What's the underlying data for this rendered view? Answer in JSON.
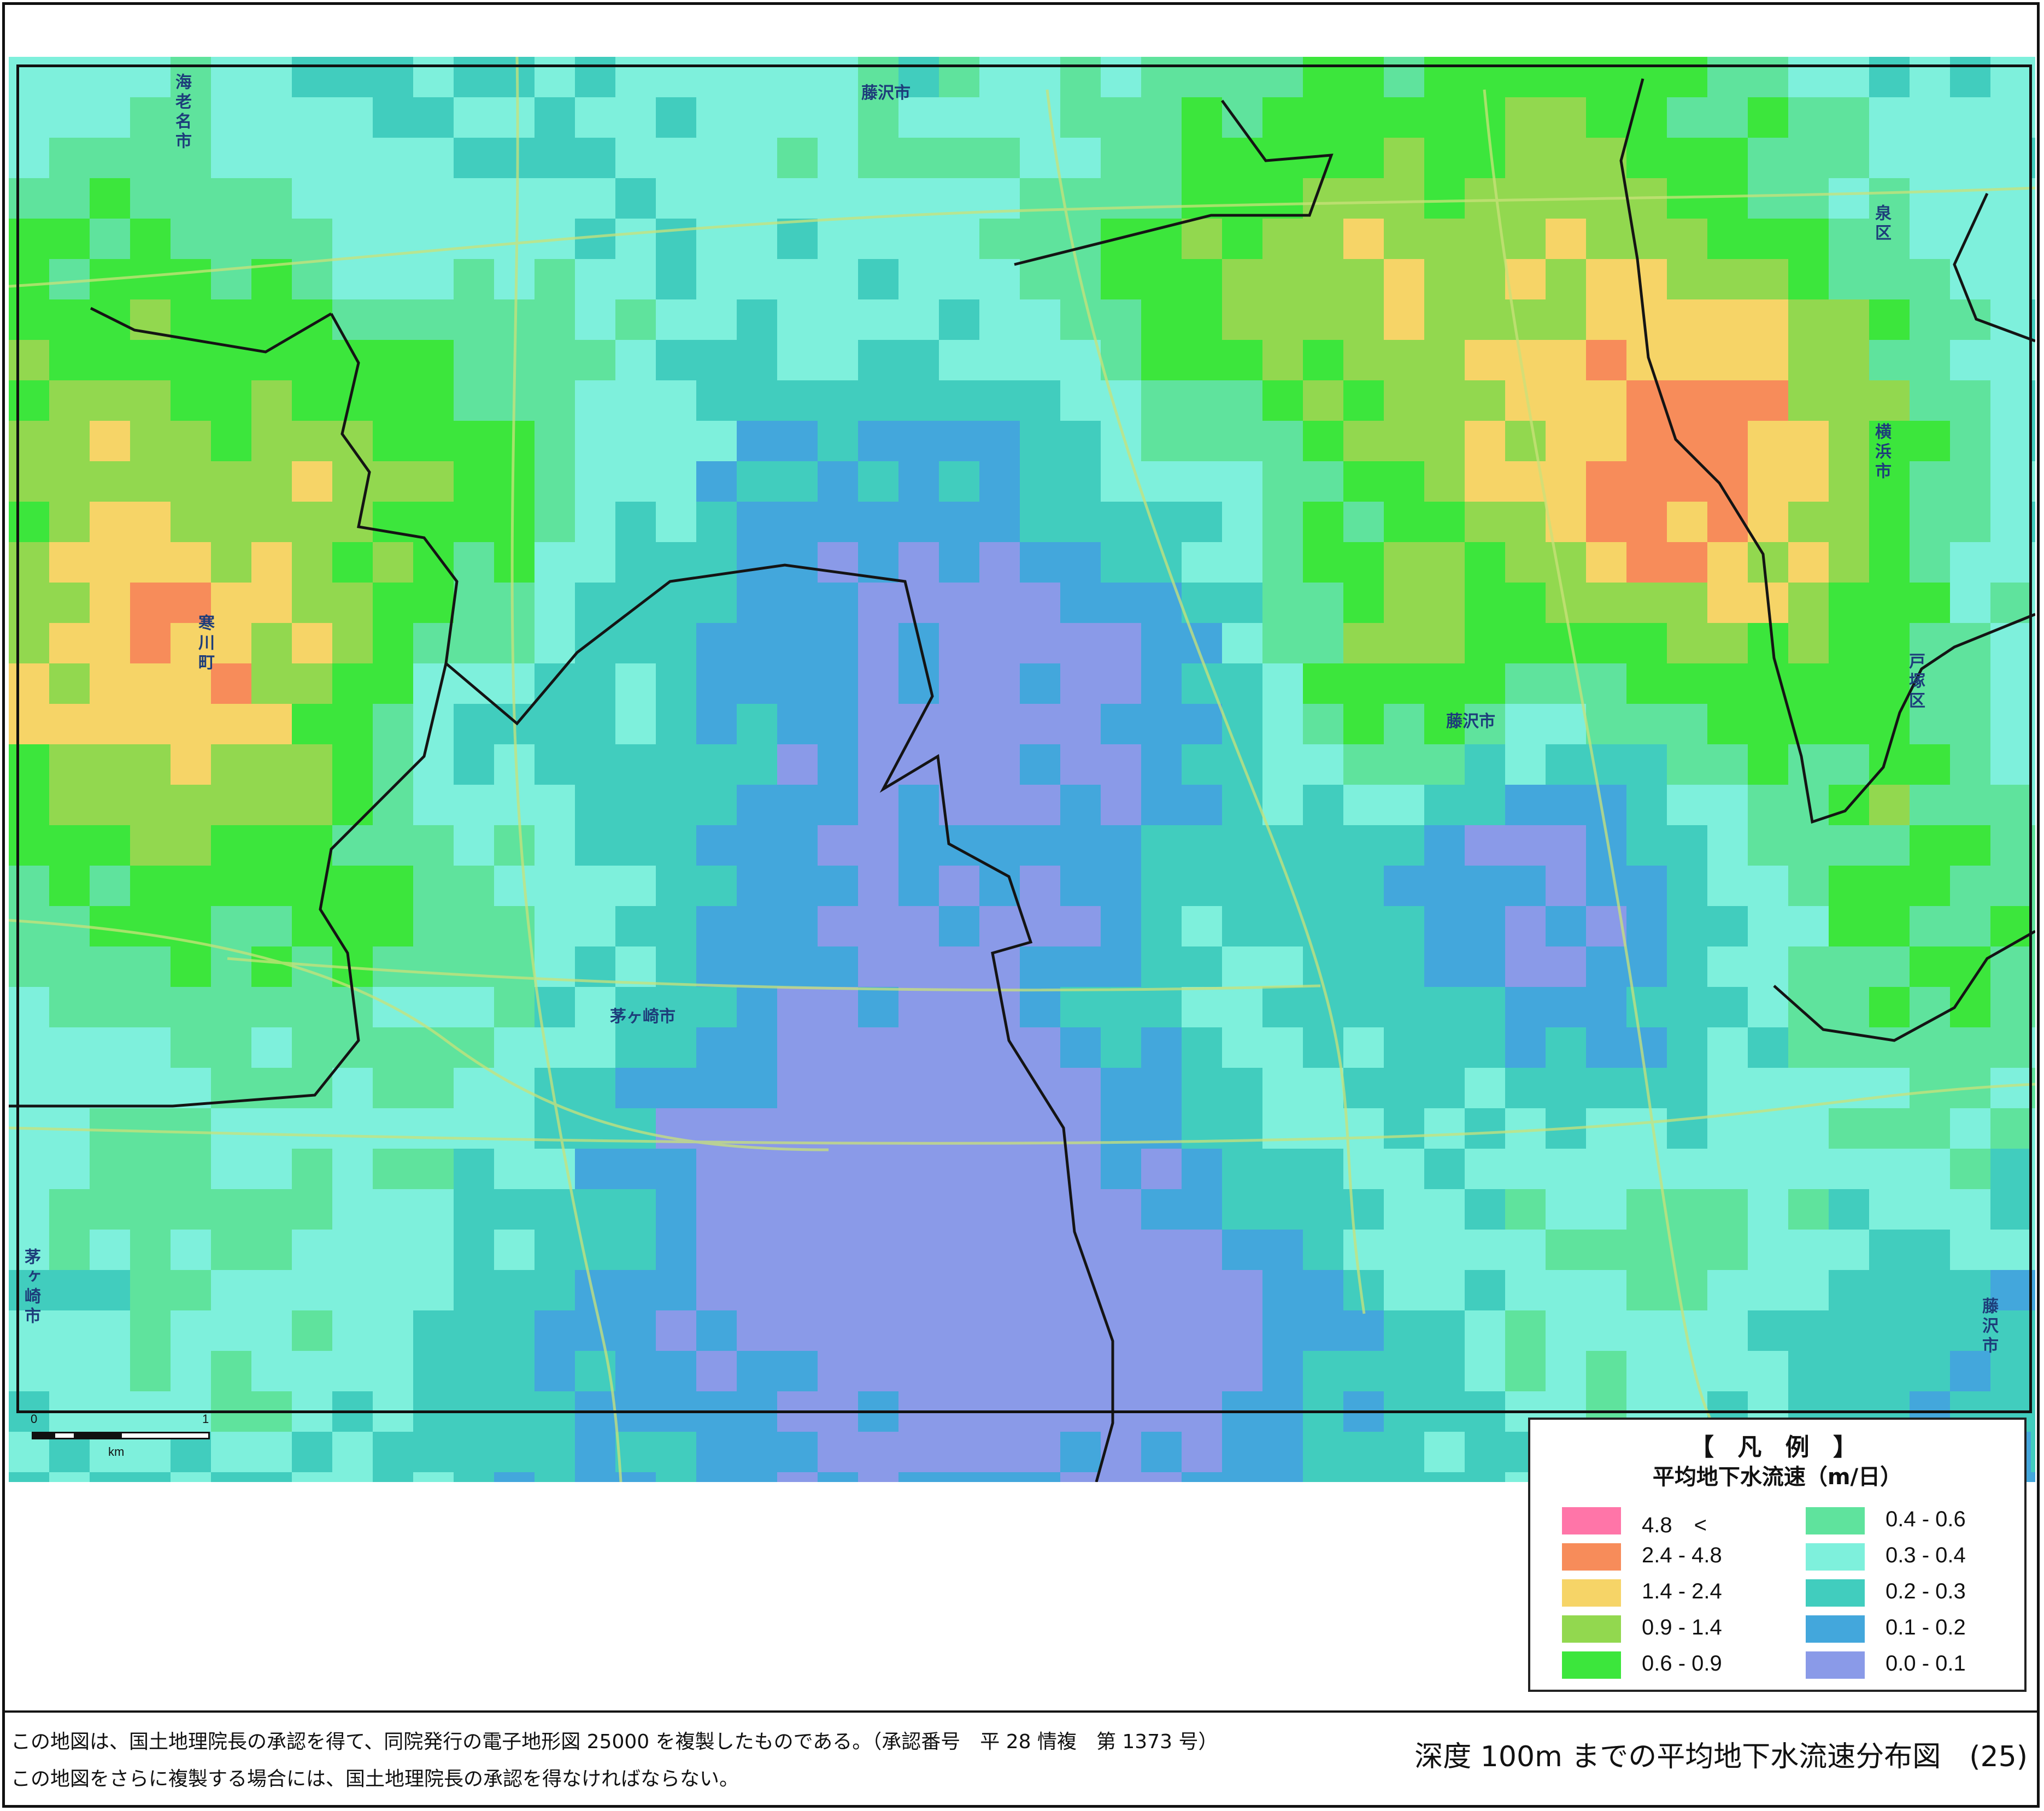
{
  "map": {
    "places": [
      {
        "key": "ebina",
        "text": "海老名市",
        "vertical": true
      },
      {
        "key": "fujisawa_top",
        "text": "藤沢市",
        "vertical": false
      },
      {
        "key": "izumi",
        "text": "泉区",
        "vertical": true
      },
      {
        "key": "yokohama",
        "text": "横浜市",
        "vertical": true
      },
      {
        "key": "samukawa",
        "text": "寒川町",
        "vertical": true
      },
      {
        "key": "totsuka",
        "text": "戸塚区",
        "vertical": true
      },
      {
        "key": "fujisawa_mid",
        "text": "藤沢市",
        "vertical": false
      },
      {
        "key": "chigasaki_mid",
        "text": "茅ヶ崎市",
        "vertical": false
      },
      {
        "key": "chigasaki_left",
        "text": "茅ヶ崎市",
        "vertical": true
      },
      {
        "key": "fujisawa_right",
        "text": "藤沢市",
        "vertical": true
      }
    ],
    "scale": {
      "tick_start": "0",
      "tick_end": "1",
      "unit": "km"
    }
  },
  "legend": {
    "title": "【 凡 例 】",
    "subtitle": "平均地下水流速（m/日）",
    "items": [
      {
        "label": "4.8　<",
        "color": "#ff75a8"
      },
      {
        "label": "2.4 - 4.8",
        "color": "#f78c5a"
      },
      {
        "label": "1.4 - 2.4",
        "color": "#f6d467"
      },
      {
        "label": "0.9 - 1.4",
        "color": "#92d84f"
      },
      {
        "label": "0.6 - 0.9",
        "color": "#3ce63c"
      },
      {
        "label": "0.4 - 0.6",
        "color": "#5fe39d"
      },
      {
        "label": "0.3 - 0.4",
        "color": "#7ef0dc"
      },
      {
        "label": "0.2 - 0.3",
        "color": "#41cdbe"
      },
      {
        "label": "0.1 - 0.2",
        "color": "#43a7dc"
      },
      {
        "label": "0.0 - 0.1",
        "color": "#8a9ae8"
      }
    ]
  },
  "footer": {
    "note1": "この地図は、国土地理院長の承認を得て、同院発行の電子地形図 25000 を複製したものである。（承認番号　平 28 情複　第 1373 号）",
    "note2": "この地図をさらに複製する場合には、国土地理院長の承認を得なければならない。",
    "figure_title": "深度 100m までの平均地下水流速分布図　(25)"
  }
}
